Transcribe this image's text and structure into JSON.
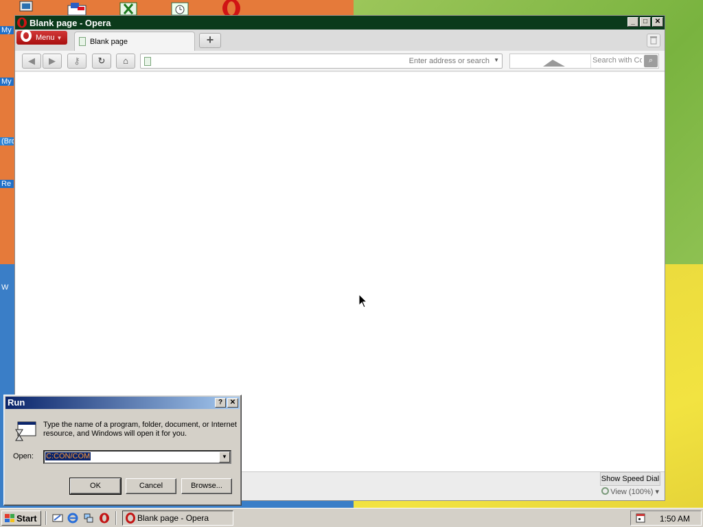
{
  "desktop": {
    "labels": [
      "My",
      "My I",
      "(Bro",
      "Re",
      "W"
    ]
  },
  "opera": {
    "window_title": "Blank page - Opera",
    "menu_label": "Menu",
    "tab_label": "Blank page",
    "address_placeholder": "Enter address or search",
    "search_placeholder": "Search with Co",
    "speed_dial_label": "Show Speed Dial",
    "zoom_label": "View (100%)"
  },
  "run_dialog": {
    "title": "Run",
    "description": "Type the name of a program, folder, document, or Internet resource, and Windows will open it for you.",
    "open_label": "Open:",
    "open_value": "C:CON/COM",
    "ok_label": "OK",
    "cancel_label": "Cancel",
    "browse_label": "Browse..."
  },
  "taskbar": {
    "start_label": "Start",
    "task_label": "Blank page - Opera",
    "clock": "1:50 AM"
  },
  "colors": {
    "opera_red": "#c31616",
    "title_blue": "#0a246a",
    "selection_text": "#ff9b3a"
  }
}
